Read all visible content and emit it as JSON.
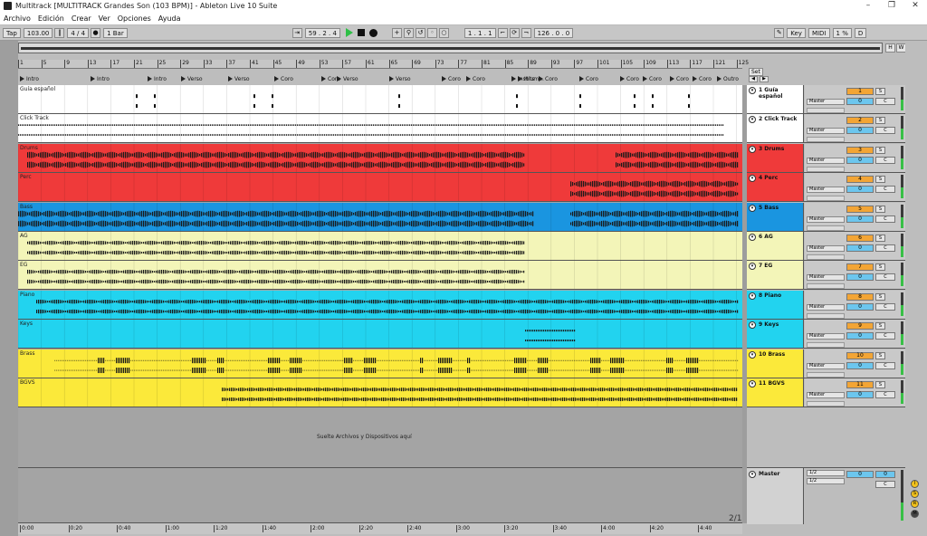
{
  "window": {
    "title": "Multitrack [MULTITRACK Grandes Son (103 BPM)] - Ableton Live 10 Suite",
    "controls": [
      "–",
      "❐",
      "✕"
    ]
  },
  "menu": [
    "Archivo",
    "Edición",
    "Crear",
    "Ver",
    "Opciones",
    "Ayuda"
  ],
  "controlbar": {
    "tap": "Tap",
    "tempo": "103.00",
    "time_sig": "4 / 4",
    "quant": "1 Bar",
    "position": "59 .  2 .  4",
    "loop_start": "1 .  1 .  1",
    "loop_length": "126 .  0 .  0",
    "key_label": "Key",
    "midi_label": "MIDI",
    "cpu": "1 %",
    "d_label": "D"
  },
  "overview_buttons": [
    "H",
    "W"
  ],
  "ruler_ticks": [
    "1",
    "5",
    "9",
    "13",
    "17",
    "21",
    "25",
    "29",
    "33",
    "37",
    "41",
    "45",
    "49",
    "53",
    "57",
    "61",
    "65",
    "69",
    "73",
    "77",
    "81",
    "85",
    "89",
    "93",
    "97",
    "101",
    "105",
    "109",
    "113",
    "117",
    "121",
    "125"
  ],
  "locators": [
    {
      "label": "Intro"
    },
    {
      "label": "Intro"
    },
    {
      "label": "Intro"
    },
    {
      "label": "Verso"
    },
    {
      "label": "Verso"
    },
    {
      "label": "Coro"
    },
    {
      "label": "Coro"
    },
    {
      "label": "Verso"
    },
    {
      "label": "Verso"
    },
    {
      "label": "Coro"
    },
    {
      "label": "Coro"
    },
    {
      "label": "Instrum..."
    },
    {
      "label": "Hits"
    },
    {
      "label": "Coro"
    },
    {
      "label": "Coro"
    },
    {
      "label": "Coro"
    },
    {
      "label": "Coro"
    },
    {
      "label": "Coro"
    },
    {
      "label": "Coro"
    },
    {
      "label": "Outro"
    }
  ],
  "set_label": "Set",
  "drop_text": "Suelte Archivos y Dispositivos aquí",
  "tracks": [
    {
      "lane_label": "Guía español",
      "name": "1 Guía español",
      "num": "1",
      "color": "#ffffff",
      "route": "Master",
      "vol": "0",
      "pan": "C"
    },
    {
      "lane_label": "Click Track",
      "name": "2 Click Track",
      "num": "2",
      "color": "#ffffff",
      "route": "Master",
      "vol": "0",
      "pan": "C"
    },
    {
      "lane_label": "Drums",
      "name": "3 Drums",
      "num": "3",
      "color": "#ef3a3a",
      "route": "Master",
      "vol": "0",
      "pan": "C"
    },
    {
      "lane_label": "Perc",
      "name": "4 Perc",
      "num": "4",
      "color": "#ef3a3a",
      "route": "Master",
      "vol": "0",
      "pan": "C"
    },
    {
      "lane_label": "Bass",
      "name": "5 Bass",
      "num": "5",
      "color": "#1a95e0",
      "route": "Master",
      "vol": "0",
      "pan": "C"
    },
    {
      "lane_label": "AG",
      "name": "6 AG",
      "num": "6",
      "color": "#f3f5b8",
      "route": "Master",
      "vol": "0",
      "pan": "C"
    },
    {
      "lane_label": "EG",
      "name": "7 EG",
      "num": "7",
      "color": "#f3f5b8",
      "route": "Master",
      "vol": "0",
      "pan": "C"
    },
    {
      "lane_label": "Piano",
      "name": "8 Piano",
      "num": "8",
      "color": "#22d3ef",
      "route": "Master",
      "vol": "0",
      "pan": "C"
    },
    {
      "lane_label": "Keys",
      "name": "9 Keys",
      "num": "9",
      "color": "#22d3ef",
      "route": "Master",
      "vol": "0",
      "pan": "C"
    },
    {
      "lane_label": "Brass",
      "name": "10 Brass",
      "num": "10",
      "color": "#fbe93a",
      "route": "Master",
      "vol": "0",
      "pan": "C"
    },
    {
      "lane_label": "BGVS",
      "name": "11 BGVS",
      "num": "11",
      "color": "#fbe93a",
      "route": "Master",
      "vol": "0",
      "pan": "C"
    }
  ],
  "master": {
    "name": "Master",
    "out1": "1/2",
    "out2": "1/2",
    "vol": "0",
    "vol2": "0",
    "pan": "C"
  },
  "time_ticks": [
    "0:00",
    "0:20",
    "0:40",
    "1:00",
    "1:20",
    "1:40",
    "2:00",
    "2:20",
    "2:40",
    "3:00",
    "3:20",
    "3:40",
    "4:00",
    "4:20",
    "4:40"
  ],
  "page_indicator": "2/1"
}
